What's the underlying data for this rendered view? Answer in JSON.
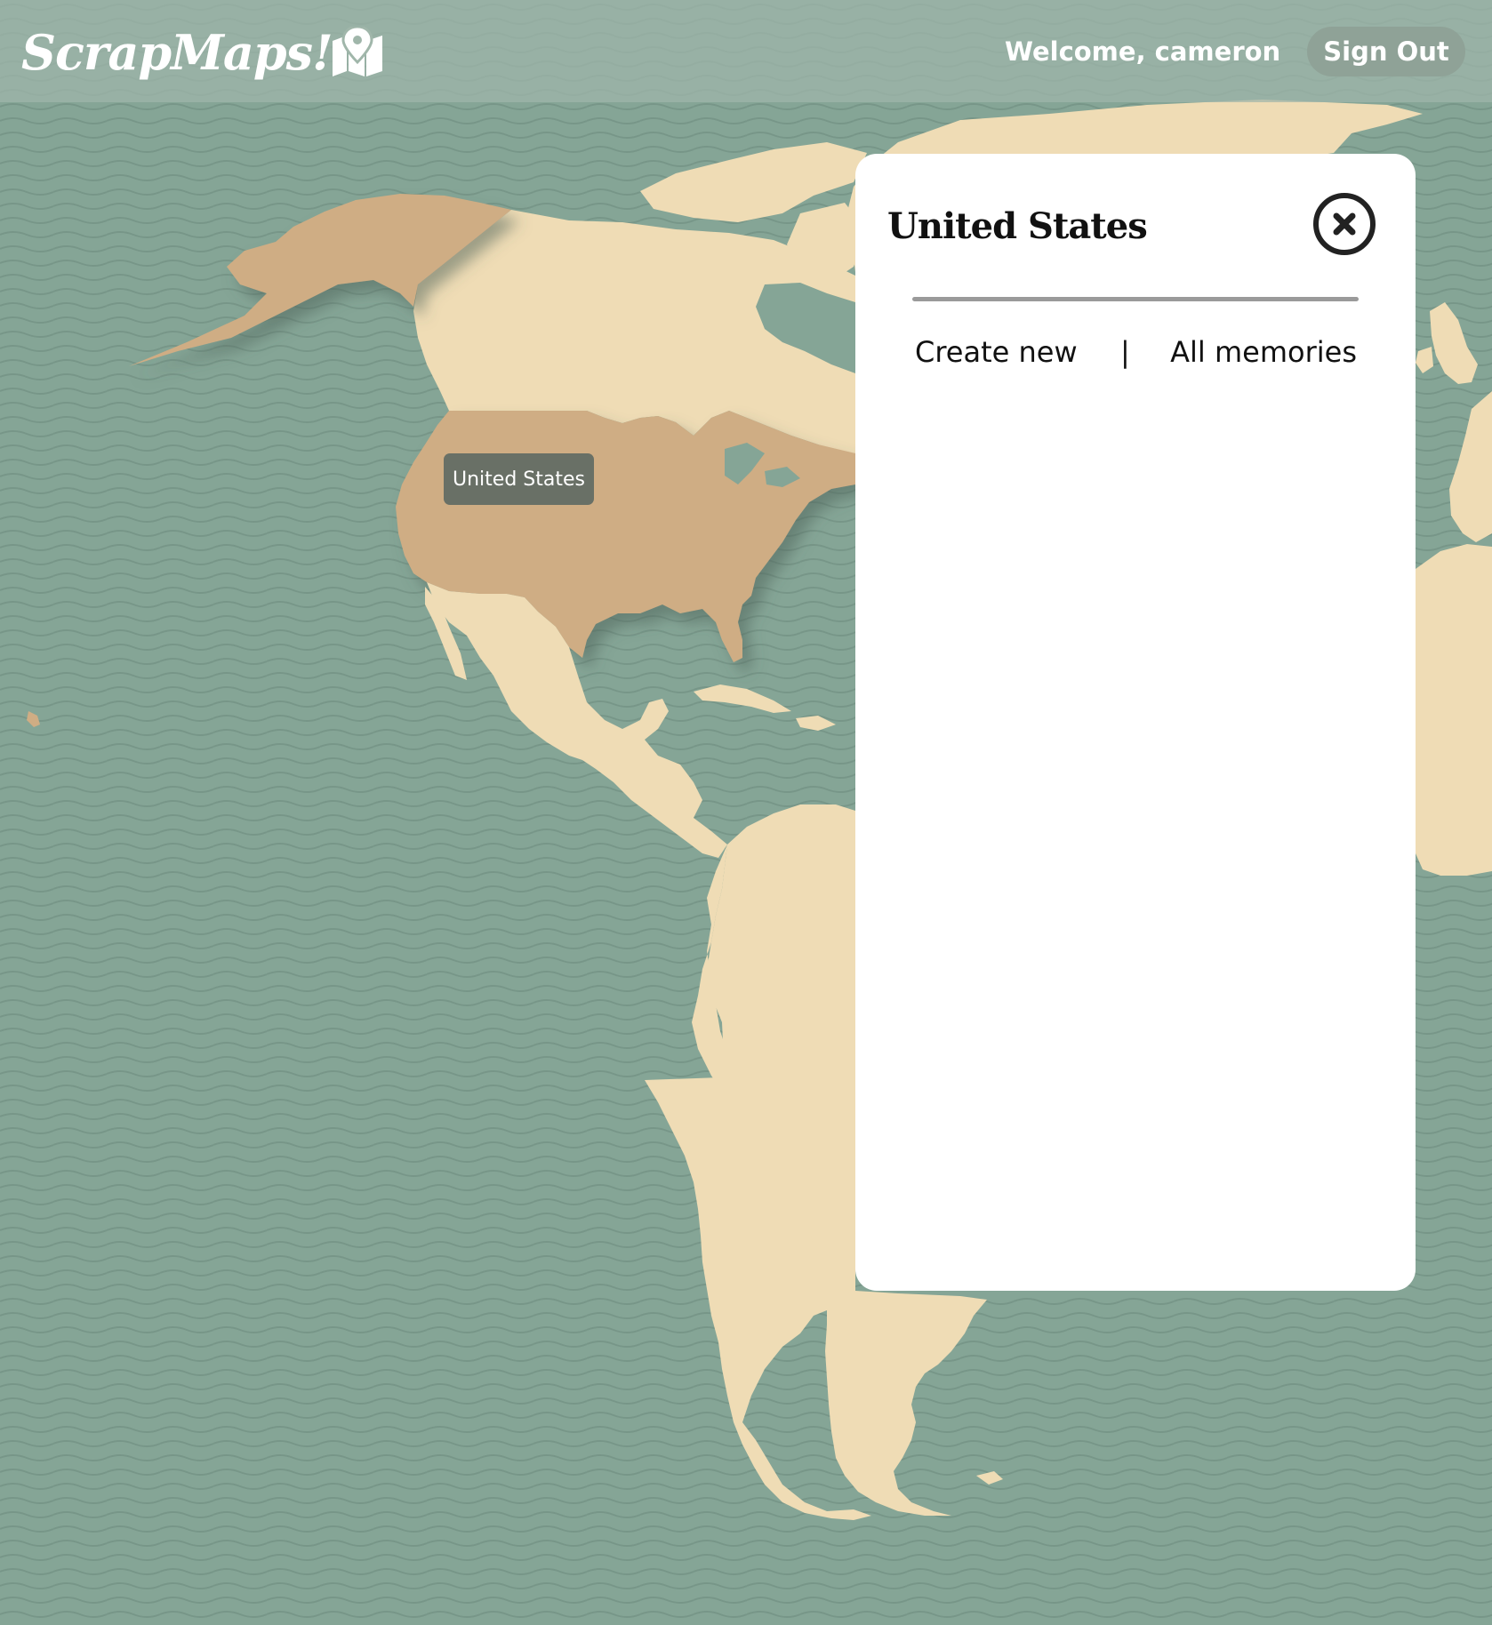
{
  "app": {
    "title": "ScrapMaps!",
    "logo_icon": "map-pin-icon"
  },
  "header": {
    "welcome_text": "Welcome, cameron",
    "sign_out_label": "Sign Out"
  },
  "map": {
    "hovered_country": "United States",
    "colors": {
      "ocean": "#85a596",
      "land": "#efdcb5",
      "selected_country": "#cfad84",
      "tooltip_bg": "#697066"
    }
  },
  "panel": {
    "title": "United States",
    "close_icon": "close-circle-icon",
    "tabs": [
      {
        "label": "Create new"
      },
      {
        "label": "All memories"
      }
    ],
    "tab_separator": "|"
  }
}
